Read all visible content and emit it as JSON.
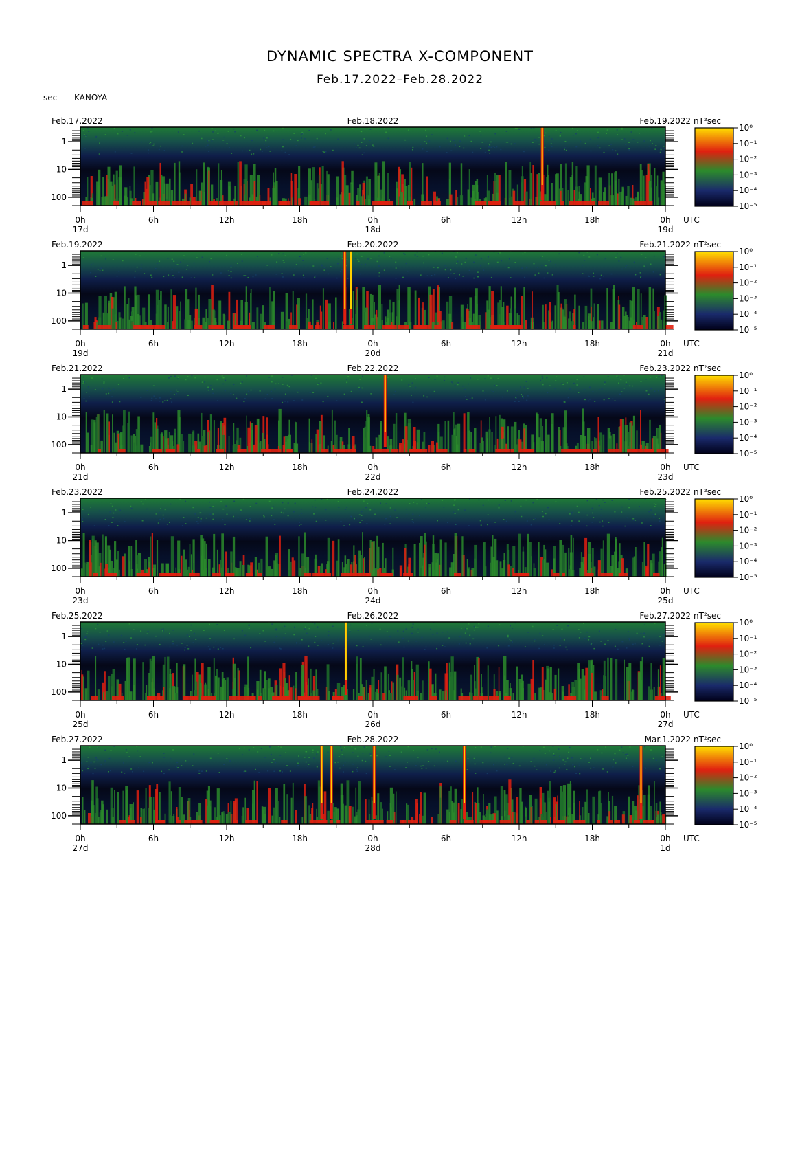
{
  "header": {
    "title": "DYNAMIC SPECTRA X-COMPONENT",
    "subtitle": "Feb.17.2022–Feb.28.2022",
    "unit": "sec",
    "station": "KANOYA"
  },
  "colors": {
    "background": "#000000",
    "low": "#1a2a6b",
    "mid": "#2c8a2c",
    "high": "#e02010",
    "peak": "#ffd000"
  },
  "chart_data": {
    "type": "heatmap",
    "title": "DYNAMIC SPECTRA X-COMPONENT",
    "subtitle": "Feb.17.2022–Feb.28.2022",
    "ylabel": "sec",
    "y_ticks": [
      "1",
      "10",
      "100"
    ],
    "y_scale": "log",
    "x_ticks": [
      "0h",
      "6h",
      "12h",
      "18h",
      "0h",
      "6h",
      "12h",
      "18h",
      "0h"
    ],
    "x_unit": "UTC",
    "colorbar": {
      "unit": "nT²sec",
      "labels": [
        "10⁰",
        "10⁻¹",
        "10⁻²",
        "10⁻³",
        "10⁻⁴",
        "10⁻⁵"
      ]
    },
    "panels": [
      {
        "start_label": "Feb.17.2022",
        "mid_label": "Feb.18.2022",
        "end_label": "Feb.19.2022",
        "day_labels": [
          "17d",
          "18d",
          "19d"
        ],
        "spikes_hours": [
          37.9
        ]
      },
      {
        "start_label": "Feb.19.2022",
        "mid_label": "Feb.20.2022",
        "end_label": "Feb.21.2022",
        "day_labels": [
          "19d",
          "20d",
          "21d"
        ],
        "spikes_hours": [
          21.7,
          22.2
        ]
      },
      {
        "start_label": "Feb.21.2022",
        "mid_label": "Feb.22.2022",
        "end_label": "Feb.23.2022",
        "day_labels": [
          "21d",
          "22d",
          "23d"
        ],
        "spikes_hours": [
          25.0
        ]
      },
      {
        "start_label": "Feb.23.2022",
        "mid_label": "Feb.24.2022",
        "end_label": "Feb.25.2022",
        "day_labels": [
          "23d",
          "24d",
          "25d"
        ],
        "spikes_hours": []
      },
      {
        "start_label": "Feb.25.2022",
        "mid_label": "Feb.26.2022",
        "end_label": "Feb.27.2022",
        "day_labels": [
          "25d",
          "26d",
          "27d"
        ],
        "spikes_hours": [
          21.8
        ]
      },
      {
        "start_label": "Feb.27.2022",
        "mid_label": "Feb.28.2022",
        "end_label": "Mar.1.2022",
        "day_labels": [
          "27d",
          "28d",
          "1d"
        ],
        "spikes_hours": [
          19.8,
          20.6,
          24.1,
          31.5,
          46.0
        ]
      }
    ]
  }
}
